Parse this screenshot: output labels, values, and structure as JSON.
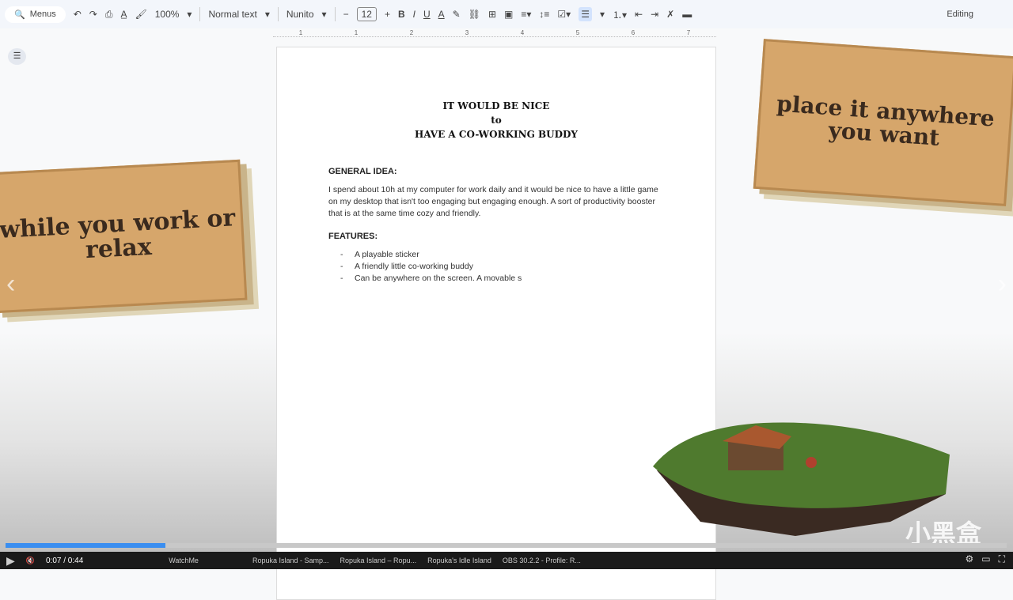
{
  "toolbar": {
    "menus": "Menus",
    "zoom": "100%",
    "style": "Normal text",
    "font": "Nunito",
    "font_size": "12",
    "editing": "Editing"
  },
  "ruler": [
    "1",
    "1",
    "2",
    "3",
    "4",
    "5",
    "6",
    "7"
  ],
  "doc": {
    "title_lines": [
      "IT WOULD BE NICE",
      "to",
      "HAVE A CO-WORKING BUDDY"
    ],
    "general_heading": "GENERAL IDEA:",
    "general_text": "I spend about 10h at my computer for work daily and it would be nice to have a little game on my desktop that isn't too engaging but engaging enough. A sort of productivity booster that is at the same time cozy and friendly.",
    "features_heading": "FEATURES:",
    "features": [
      "A playable sticker",
      "A friendly little co-working buddy",
      "Can be anywhere on the screen. A movable s"
    ]
  },
  "stickers": {
    "left": "while you work or relax",
    "right": "place it anywhere you want"
  },
  "player": {
    "time": "0:07 / 0:44",
    "progress_percent": 16,
    "watermark": "小黑盒"
  },
  "taskbar": [
    "WatchMe",
    "Ropuka Island - Samp...",
    "Ropuka Island – Ropu...",
    "Ropuka's Idle Island",
    "OBS 30.2.2 - Profile: R..."
  ]
}
